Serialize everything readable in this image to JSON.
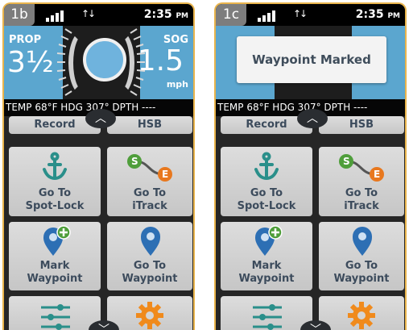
{
  "panels": [
    {
      "tag": "1b",
      "time": "2:35",
      "ampm": "PM",
      "network_arrows": "↑↓",
      "prop_label": "PROP",
      "prop_value": "3½",
      "sog_label": "SOG",
      "sog_value": "1.5",
      "sog_unit": "mph",
      "sensor": "TEMP 68°F  HDG 307°  DPTH   ----",
      "toast": "",
      "buttons": {
        "record": "Record",
        "hsb": "HSB",
        "spotlock_1": "Go To",
        "spotlock_2": "Spot-Lock",
        "itrack_1": "Go To",
        "itrack_2": "iTrack",
        "mark_1": "Mark",
        "mark_2": "Waypoint",
        "goto_wp_1": "Go To",
        "goto_wp_2": "Waypoint"
      },
      "itrack_start": "S",
      "itrack_end": "E"
    },
    {
      "tag": "1c",
      "time": "2:35",
      "ampm": "PM",
      "network_arrows": "↑↓",
      "sensor": "TEMP 68°F  HDG 307°  DPTH   ----",
      "toast": "Waypoint Marked",
      "buttons": {
        "record": "Record",
        "hsb": "HSB",
        "spotlock_1": "Go To",
        "spotlock_2": "Spot-Lock",
        "itrack_1": "Go To",
        "itrack_2": "iTrack",
        "mark_1": "Mark",
        "mark_2": "Waypoint",
        "goto_wp_1": "Go To",
        "goto_wp_2": "Waypoint"
      },
      "itrack_start": "S",
      "itrack_end": "E"
    }
  ],
  "icons": {
    "spotlock": "anchor-icon",
    "itrack": "track-route-icon",
    "mark": "add-waypoint-pin-icon",
    "goto_waypoint": "waypoint-pin-icon",
    "settings": "sliders-icon",
    "gear": "gear-icon",
    "scroll_up": "chevron-up-icon",
    "scroll_down": "chevron-down-icon"
  },
  "colors": {
    "accent_border": "#e9b44c",
    "gauge_bg": "#5ba6cf",
    "teal_icon": "#2a8f8a",
    "pin_blue": "#2d6fb4",
    "track_green": "#4f9e3b",
    "track_orange": "#e8781e",
    "gear_orange": "#f08a1c"
  }
}
